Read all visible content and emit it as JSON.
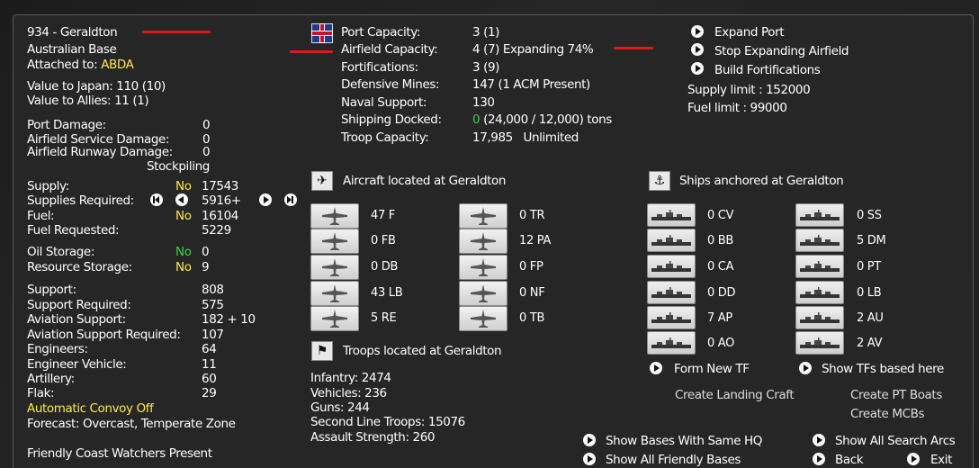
{
  "base": {
    "title": "934 - Geraldton",
    "type": "Australian Base",
    "attached_label": "Attached to:",
    "attached_value": "ABDA",
    "value_japan": "Value to Japan: 110 (10)",
    "value_allies": "Value to Allies: 11 (1)"
  },
  "damage": {
    "port_label": "Port Damage:",
    "port_value": "0",
    "afs_label": "Airfield Service Damage:",
    "afs_value": "0",
    "afr_label": "Airfield Runway Damage:",
    "afr_value": "0"
  },
  "supply": {
    "stockpiling": "Stockpiling",
    "supply_label": "Supply:",
    "supply_flag": "No",
    "supply_value": "17543",
    "req_label": "Supplies Required:",
    "req_value": "5916+",
    "fuel_label": "Fuel:",
    "fuel_flag": "No",
    "fuel_value": "16104",
    "fuelreq_label": "Fuel Requested:",
    "fuelreq_value": "5229",
    "oil_label": "Oil Storage:",
    "oil_flag": "No",
    "oil_value": "0",
    "res_label": "Resource Storage:",
    "res_flag": "No",
    "res_value": "9"
  },
  "support": [
    {
      "label": "Support:",
      "value": "808"
    },
    {
      "label": "Support Required:",
      "value": "575"
    },
    {
      "label": "Aviation Support:",
      "value": "182 + 10"
    },
    {
      "label": "Aviation Support Required:",
      "value": "107"
    },
    {
      "label": "Engineers:",
      "value": "64"
    },
    {
      "label": "Engineer Vehicle:",
      "value": "11"
    },
    {
      "label": "Artillery:",
      "value": "60"
    },
    {
      "label": "Flak:",
      "value": "29"
    }
  ],
  "convoy": "Automatic Convoy Off",
  "forecast": "Forecast: Overcast, Temperate Zone",
  "coastwatchers": "Friendly Coast Watchers Present",
  "port_info": [
    {
      "label": "Port Capacity:",
      "value": "3 (1)"
    },
    {
      "label": "Airfield Capacity:",
      "value": "4 (7) Expanding 74%"
    },
    {
      "label": "Fortifications:",
      "value": "3 (9)"
    },
    {
      "label": "Defensive Mines:",
      "value": "147 (1 ACM Present)"
    },
    {
      "label": "Naval Support:",
      "value": "130"
    },
    {
      "label": "Shipping Docked:",
      "value": "(24,000 / 12,000) tons",
      "value_prefix": "0"
    },
    {
      "label": "Troop Capacity:",
      "value": "17,985   Unlimited"
    }
  ],
  "actions_top": [
    "Expand Port",
    "Stop Expanding Airfield",
    "Build Fortifications"
  ],
  "supply_limit": "Supply limit : 152000",
  "fuel_limit": "Fuel limit : 99000",
  "aircraft": {
    "title": "Aircraft located at Geraldton",
    "col1": [
      "47 F",
      "0 FB",
      "0 DB",
      "43 LB",
      "5 RE"
    ],
    "col2": [
      "0 TR",
      "12 PA",
      "0 FP",
      "0 NF",
      "0 TB"
    ]
  },
  "ships": {
    "title": "Ships anchored at Geraldton",
    "col1": [
      "0 CV",
      "0 BB",
      "0 CA",
      "0 DD",
      "7 AP",
      "0 AO"
    ],
    "col2": [
      "0 SS",
      "5 DM",
      "0 PT",
      "0 LB",
      "2 AU",
      "2 AV"
    ]
  },
  "ship_buttons": [
    "Form New TF",
    "Show TFs based here"
  ],
  "create_links": [
    "Create Landing Craft",
    "Create PT Boats",
    "Create MCBs"
  ],
  "troops": {
    "title": "Troops located at Geraldton",
    "lines": [
      "Infantry: 2474",
      "Vehicles: 236",
      "Guns: 244",
      "Second Line Troops: 15076",
      "Assault Strength: 260"
    ]
  },
  "bottom_buttons": [
    "Show Bases With Same HQ",
    "Show All Friendly Bases",
    "Show All Search Arcs",
    "Back",
    "Exit"
  ],
  "colors": {
    "yellow": "#ffe84a",
    "green": "#3cd23c",
    "red_marks": "#e01818",
    "panel": "#262626"
  }
}
